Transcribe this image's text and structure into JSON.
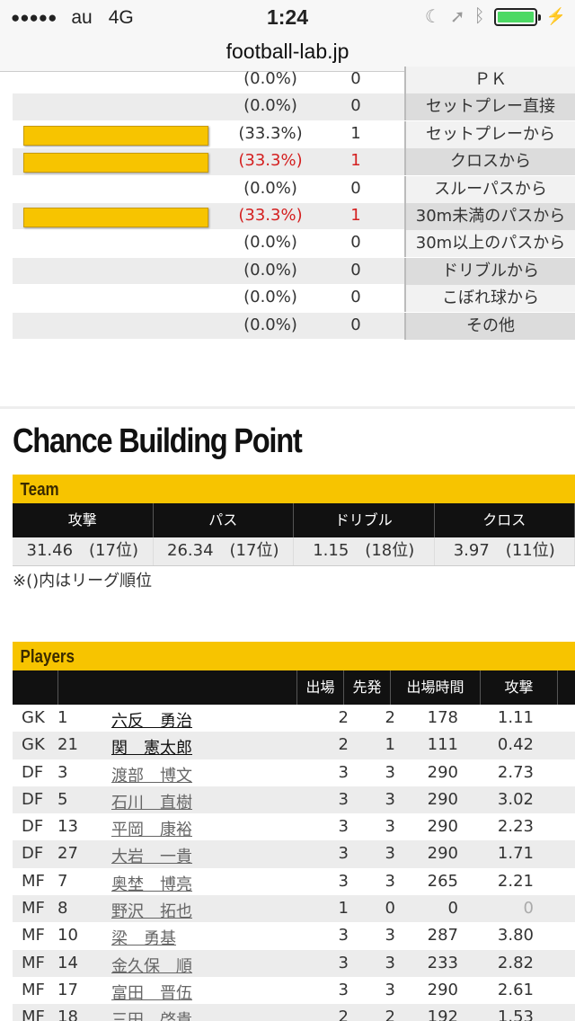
{
  "status_bar": {
    "signal_dots": "●●●●●",
    "carrier": "au",
    "network": "4G",
    "time": "1:24",
    "battery_color": "#4cd964"
  },
  "url_bar": {
    "url": "football-lab.jp"
  },
  "goal_pattern": {
    "rows": [
      {
        "pct": "(0.0%)",
        "count": "0",
        "label": "ＰＫ",
        "bar": 0,
        "highlight": false
      },
      {
        "pct": "(0.0%)",
        "count": "0",
        "label": "セットプレー直接",
        "bar": 0,
        "highlight": false
      },
      {
        "pct": "(33.3%)",
        "count": "1",
        "label": "セットプレーから",
        "bar": 0.333,
        "highlight": false
      },
      {
        "pct": "(33.3%)",
        "count": "1",
        "label": "クロスから",
        "bar": 0.333,
        "highlight": true
      },
      {
        "pct": "(0.0%)",
        "count": "0",
        "label": "スルーパスから",
        "bar": 0,
        "highlight": false
      },
      {
        "pct": "(33.3%)",
        "count": "1",
        "label": "30m未満のパスから",
        "bar": 0.333,
        "highlight": true
      },
      {
        "pct": "(0.0%)",
        "count": "0",
        "label": "30m以上のパスから",
        "bar": 0,
        "highlight": false
      },
      {
        "pct": "(0.0%)",
        "count": "0",
        "label": "ドリブルから",
        "bar": 0,
        "highlight": false
      },
      {
        "pct": "(0.0%)",
        "count": "0",
        "label": "こぼれ球から",
        "bar": 0,
        "highlight": false
      },
      {
        "pct": "(0.0%)",
        "count": "0",
        "label": "その他",
        "bar": 0,
        "highlight": false
      }
    ]
  },
  "chance_building": {
    "title": "Chance Building Point",
    "team_label": "Team",
    "team_headers": [
      "攻撃",
      "パス",
      "ドリブル",
      "クロス"
    ],
    "team_values": [
      "31.46　(17位)",
      "26.34　(17位)",
      "1.15　(18位)",
      "3.97　(11位)"
    ],
    "note": "※()内はリーグ順位"
  },
  "players": {
    "label": "Players",
    "headers": {
      "apps": "出場",
      "starts": "先発",
      "minutes": "出場時間",
      "attack": "攻撃"
    },
    "rows": [
      {
        "pos": "GK",
        "num": "1",
        "name": "六反　勇治",
        "apps": "2",
        "starts": "2",
        "minutes": "178",
        "attack": "1.11",
        "dark": true
      },
      {
        "pos": "GK",
        "num": "21",
        "name": "関　憲太郎",
        "apps": "2",
        "starts": "1",
        "minutes": "111",
        "attack": "0.42",
        "dark": true
      },
      {
        "pos": "DF",
        "num": "3",
        "name": "渡部　博文",
        "apps": "3",
        "starts": "3",
        "minutes": "290",
        "attack": "2.73",
        "dark": false
      },
      {
        "pos": "DF",
        "num": "5",
        "name": "石川　直樹",
        "apps": "3",
        "starts": "3",
        "minutes": "290",
        "attack": "3.02",
        "dark": false
      },
      {
        "pos": "DF",
        "num": "13",
        "name": "平岡　康裕",
        "apps": "3",
        "starts": "3",
        "minutes": "290",
        "attack": "2.23",
        "dark": false
      },
      {
        "pos": "DF",
        "num": "27",
        "name": "大岩　一貴",
        "apps": "3",
        "starts": "3",
        "minutes": "290",
        "attack": "1.71",
        "dark": false
      },
      {
        "pos": "MF",
        "num": "7",
        "name": "奥埜　博亮",
        "apps": "3",
        "starts": "3",
        "minutes": "265",
        "attack": "2.21",
        "dark": false
      },
      {
        "pos": "MF",
        "num": "8",
        "name": "野沢　拓也",
        "apps": "1",
        "starts": "0",
        "minutes": "0",
        "attack": "0",
        "dark": false,
        "muted": true
      },
      {
        "pos": "MF",
        "num": "10",
        "name": "梁　勇基",
        "apps": "3",
        "starts": "3",
        "minutes": "287",
        "attack": "3.80",
        "dark": false
      },
      {
        "pos": "MF",
        "num": "14",
        "name": "金久保　順",
        "apps": "3",
        "starts": "3",
        "minutes": "233",
        "attack": "2.82",
        "dark": false
      },
      {
        "pos": "MF",
        "num": "17",
        "name": "富田　晋伍",
        "apps": "3",
        "starts": "3",
        "minutes": "290",
        "attack": "2.61",
        "dark": false
      },
      {
        "pos": "MF",
        "num": "18",
        "name": "三田　啓貴",
        "apps": "2",
        "starts": "2",
        "minutes": "192",
        "attack": "1.53",
        "dark": false
      }
    ]
  }
}
